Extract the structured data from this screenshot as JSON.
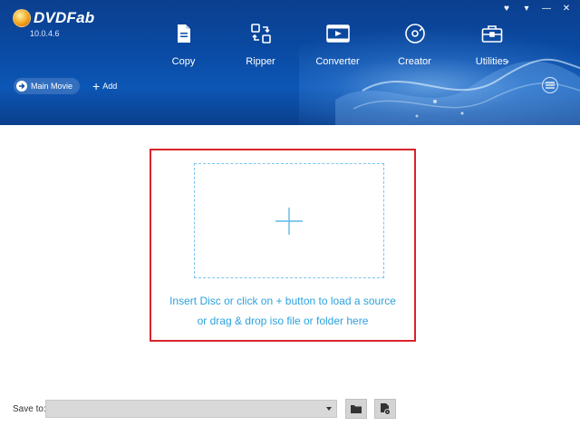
{
  "app": {
    "logo_text": "DVDFab",
    "version": "10.0.4.6"
  },
  "window_controls": [
    {
      "name": "skin-icon",
      "glyph": "♥"
    },
    {
      "name": "dropdown-icon",
      "glyph": "▾"
    },
    {
      "name": "minimize-icon",
      "glyph": "—"
    },
    {
      "name": "close-icon",
      "glyph": "✕"
    }
  ],
  "nav": [
    {
      "label": "Copy",
      "icon": "copy-icon"
    },
    {
      "label": "Ripper",
      "icon": "ripper-icon"
    },
    {
      "label": "Converter",
      "icon": "converter-icon"
    },
    {
      "label": "Creator",
      "icon": "creator-icon"
    },
    {
      "label": "Utilities",
      "icon": "utilities-icon"
    }
  ],
  "toolbar": {
    "mode_label": "Main Movie",
    "add_label": "Add"
  },
  "dropzone": {
    "line1": "Insert Disc or click on + button to load a source",
    "line2": "or drag & drop iso file or folder here"
  },
  "bottom": {
    "save_label": "Save to:",
    "save_value": ""
  },
  "colors": {
    "header_blue": "#0a4aa3",
    "accent_text": "#2da2dd",
    "highlight_red": "#d9232a"
  }
}
